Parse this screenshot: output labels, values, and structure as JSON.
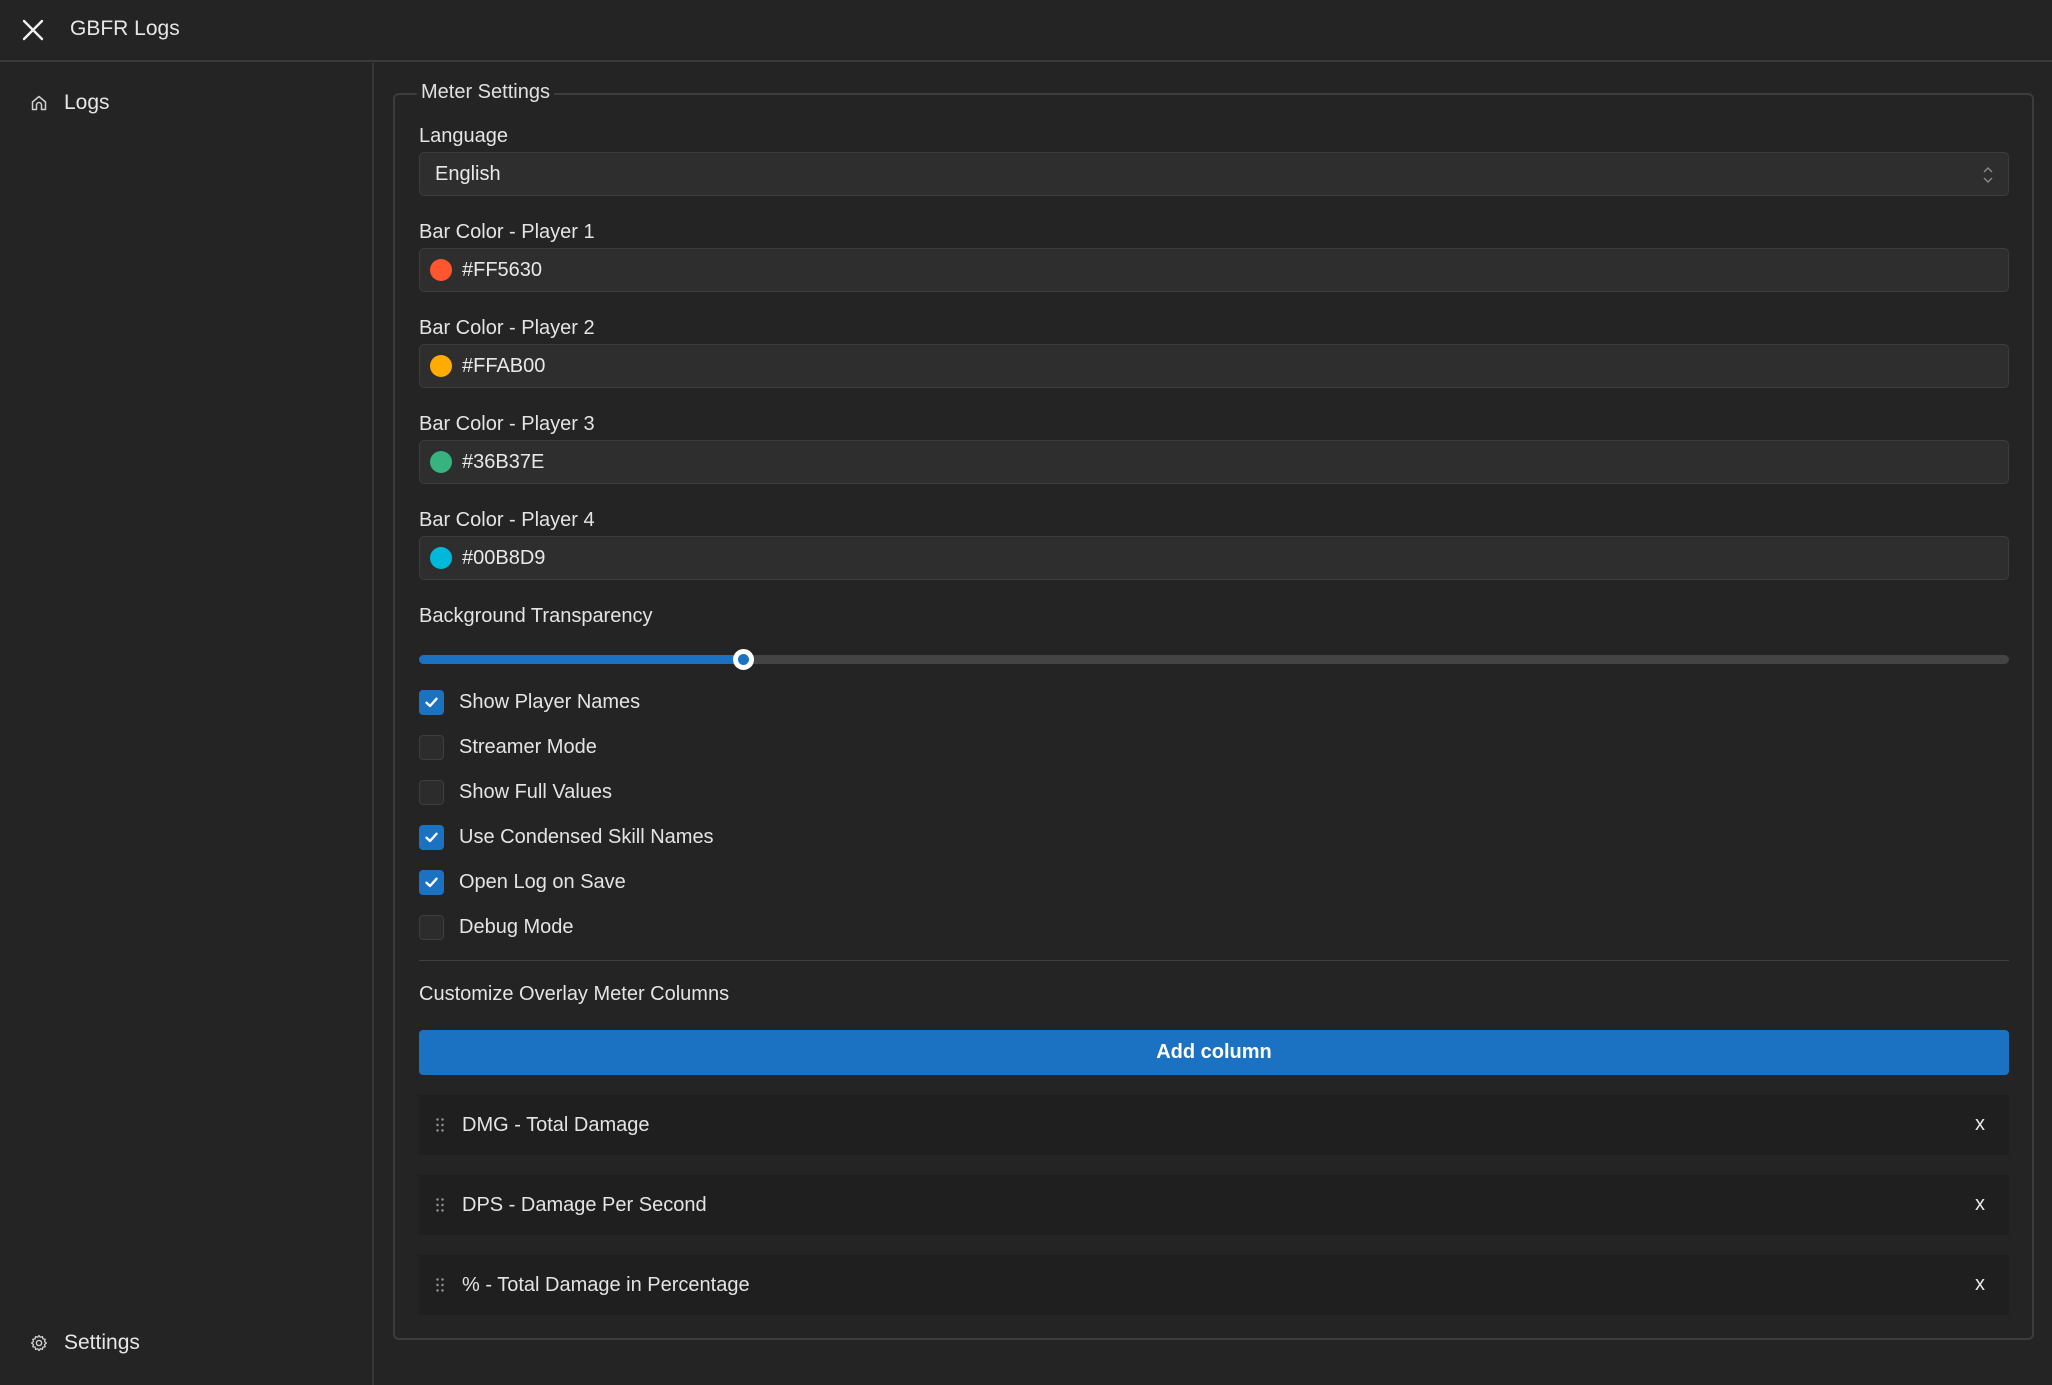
{
  "header": {
    "title": "GBFR Logs",
    "close_icon": "close-icon"
  },
  "sidebar": {
    "items": [
      {
        "label": "Logs",
        "icon": "home-icon"
      },
      {
        "label": "Settings",
        "icon": "gear-icon"
      }
    ]
  },
  "settings": {
    "section_title": "Meter Settings",
    "language": {
      "label": "Language",
      "value": "English"
    },
    "bar_colors": [
      {
        "label": "Bar Color - Player 1",
        "value": "#FF5630",
        "color": "#FF5630"
      },
      {
        "label": "Bar Color - Player 2",
        "value": "#FFAB00",
        "color": "#FFAB00"
      },
      {
        "label": "Bar Color - Player 3",
        "value": "#36B37E",
        "color": "#36B37E"
      },
      {
        "label": "Bar Color - Player 4",
        "value": "#00B8D9",
        "color": "#00B8D9"
      }
    ],
    "transparency": {
      "label": "Background Transparency",
      "value_fraction": 0.204
    },
    "toggles": [
      {
        "label": "Show Player Names",
        "checked": true
      },
      {
        "label": "Streamer Mode",
        "checked": false
      },
      {
        "label": "Show Full Values",
        "checked": false
      },
      {
        "label": "Use Condensed Skill Names",
        "checked": true
      },
      {
        "label": "Open Log on Save",
        "checked": true
      },
      {
        "label": "Debug Mode",
        "checked": false
      }
    ],
    "columns": {
      "label": "Customize Overlay Meter Columns",
      "add_button": "Add column",
      "items": [
        {
          "label": "DMG - Total Damage",
          "remove": "x"
        },
        {
          "label": "DPS - Damage Per Second",
          "remove": "x"
        },
        {
          "label": "% - Total Damage in Percentage",
          "remove": "x"
        }
      ]
    }
  },
  "colors": {
    "accent": "#1B72C2",
    "background": "#242424",
    "input_bg": "#2E2E2E"
  }
}
